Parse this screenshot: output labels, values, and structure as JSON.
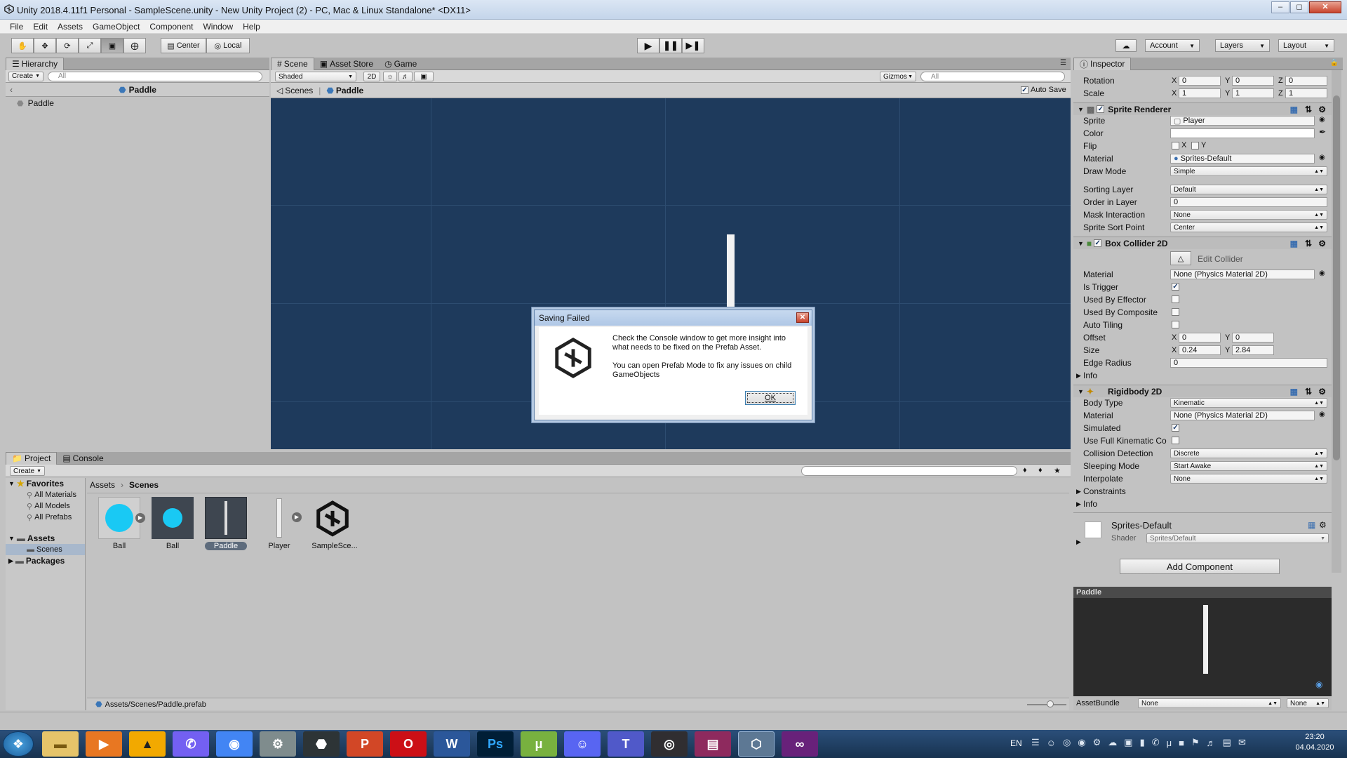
{
  "window": {
    "title": "Unity 2018.4.11f1 Personal - SampleScene.unity - New Unity Project (2) - PC, Mac & Linux Standalone* <DX11>"
  },
  "menu": [
    "File",
    "Edit",
    "Assets",
    "GameObject",
    "Component",
    "Window",
    "Help"
  ],
  "toolbar": {
    "pivot": "Center",
    "space": "Local",
    "account": "Account",
    "layers": "Layers",
    "layout": "Layout"
  },
  "hierarchy": {
    "tab": "Hierarchy",
    "create": "Create",
    "search_placeholder": "All",
    "prefab_title": "Paddle",
    "items": [
      "Paddle"
    ]
  },
  "scene": {
    "tabs": [
      "Scene",
      "Asset Store",
      "Game"
    ],
    "shading": "Shaded",
    "mode2d": "2D",
    "gizmos": "Gizmos",
    "search_placeholder": "All",
    "breadcrumb_scenes": "Scenes",
    "breadcrumb_prefab": "Paddle",
    "auto_save": "Auto Save"
  },
  "dialog": {
    "title": "Saving Failed",
    "message1": "Check the Console window to get more insight into what needs to be fixed on the Prefab Asset.",
    "message2": "You can open Prefab Mode to fix any issues on child GameObjects",
    "ok": "OK"
  },
  "project": {
    "tabs": [
      "Project",
      "Console"
    ],
    "create": "Create",
    "breadcrumb": [
      "Assets",
      "Scenes"
    ],
    "favorites_label": "Favorites",
    "favorites": [
      "All Materials",
      "All Models",
      "All Prefabs"
    ],
    "assets_label": "Assets",
    "scenes_label": "Scenes",
    "packages_label": "Packages",
    "items": [
      "Ball",
      "Ball",
      "Paddle",
      "Player",
      "SampleSce..."
    ],
    "selected_path": "Assets/Scenes/Paddle.prefab"
  },
  "inspector": {
    "tab": "Inspector",
    "transform": {
      "rotation_label": "Rotation",
      "scale_label": "Scale",
      "rotation": {
        "x": "0",
        "y": "0",
        "z": "0"
      },
      "scale": {
        "x": "1",
        "y": "1",
        "z": "1"
      }
    },
    "sprite_renderer": {
      "title": "Sprite Renderer",
      "sprite_label": "Sprite",
      "sprite": "Player",
      "color_label": "Color",
      "flip_label": "Flip",
      "flip_x": "X",
      "flip_y": "Y",
      "material_label": "Material",
      "material": "Sprites-Default",
      "draw_mode_label": "Draw Mode",
      "draw_mode": "Simple",
      "sorting_layer_label": "Sorting Layer",
      "sorting_layer": "Default",
      "order_label": "Order in Layer",
      "order": "0",
      "mask_label": "Mask Interaction",
      "mask": "None",
      "sort_point_label": "Sprite Sort Point",
      "sort_point": "Center"
    },
    "box_collider": {
      "title": "Box Collider 2D",
      "edit_collider": "Edit Collider",
      "material_label": "Material",
      "material": "None (Physics Material 2D)",
      "is_trigger_label": "Is Trigger",
      "used_by_effector_label": "Used By Effector",
      "used_by_composite_label": "Used By Composite",
      "auto_tiling_label": "Auto Tiling",
      "offset_label": "Offset",
      "offset_x": "0",
      "offset_y": "0",
      "size_label": "Size",
      "size_x": "0.24",
      "size_y": "2.84",
      "edge_radius_label": "Edge Radius",
      "edge_radius": "0",
      "info_label": "Info"
    },
    "rigidbody": {
      "title": "Rigidbody 2D",
      "body_type_label": "Body Type",
      "body_type": "Kinematic",
      "material_label": "Material",
      "material": "None (Physics Material 2D)",
      "simulated_label": "Simulated",
      "full_kinematic_label": "Use Full Kinematic Co",
      "collision_label": "Collision Detection",
      "collision": "Discrete",
      "sleeping_label": "Sleeping Mode",
      "sleeping": "Start Awake",
      "interpolate_label": "Interpolate",
      "interpolate": "None",
      "constraints_label": "Constraints",
      "info_label": "Info"
    },
    "material": {
      "name": "Sprites-Default",
      "shader_label": "Shader",
      "shader": "Sprites/Default"
    },
    "add_component": "Add Component",
    "preview_title": "Paddle",
    "assetbundle_label": "AssetBundle",
    "assetbundle": "None",
    "assetbundle_variant": "None"
  },
  "taskbar": {
    "lang": "EN",
    "time": "23:20",
    "date": "04.04.2020",
    "apps": [
      "explorer",
      "media",
      "vlc",
      "viber",
      "chrome",
      "settings",
      "unity-hub",
      "powerpoint",
      "opera",
      "word",
      "photoshop",
      "utorrent",
      "discord",
      "teams",
      "obs",
      "winrar",
      "unity",
      "visual-studio"
    ]
  },
  "colors": {
    "scene_bg": "#1e3a5c",
    "panel_bg": "#c2c2c2",
    "accent": "#3c7fb1"
  }
}
